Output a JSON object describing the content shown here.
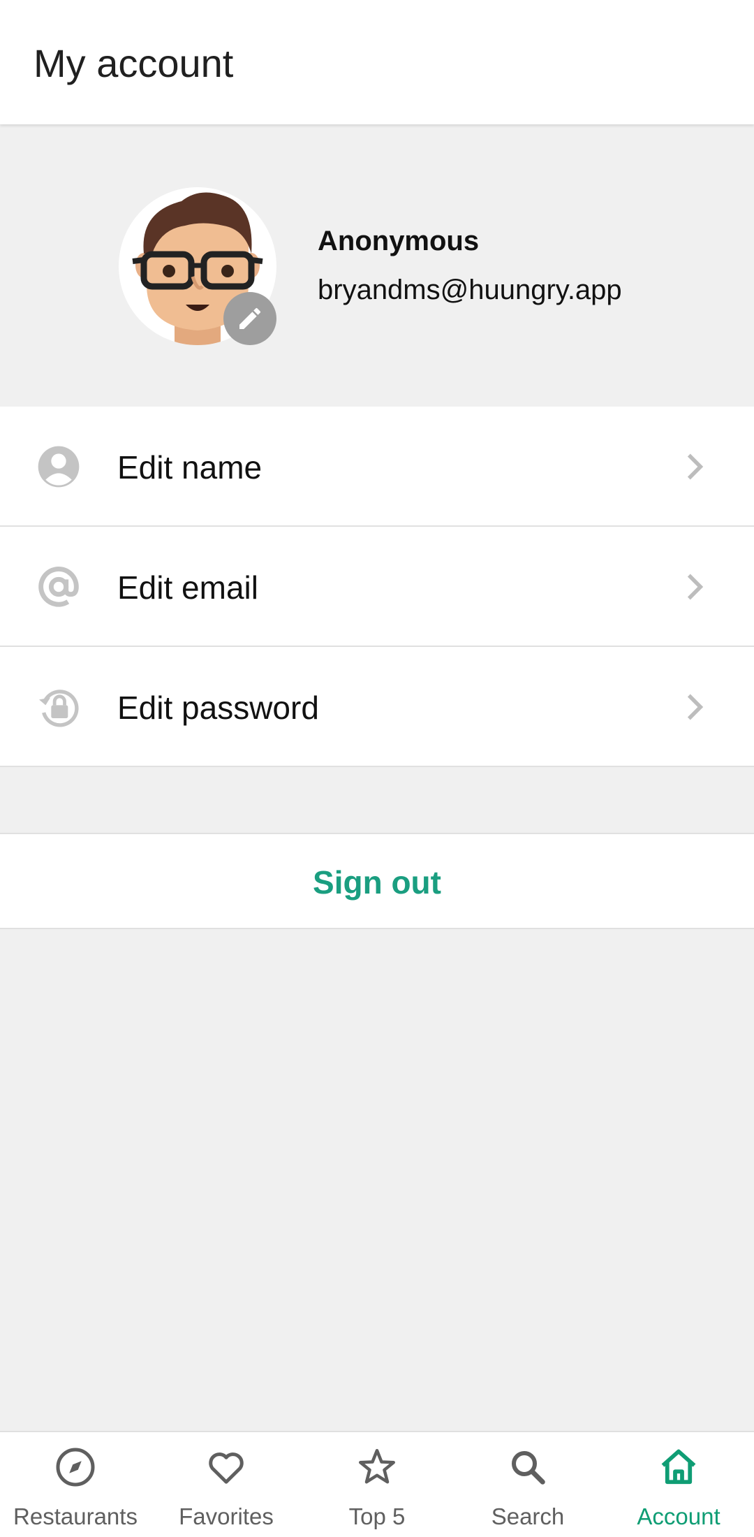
{
  "appbar": {
    "title": "My account"
  },
  "profile": {
    "name": "Anonymous",
    "email": "bryandms@huungry.app",
    "avatar_icon": "avatar-face",
    "edit_icon": "pencil-icon"
  },
  "menu": {
    "items": [
      {
        "label": "Edit name",
        "icon": "person-icon"
      },
      {
        "label": "Edit email",
        "icon": "at-sign-icon"
      },
      {
        "label": "Edit password",
        "icon": "lock-reset-icon"
      }
    ]
  },
  "signout": {
    "label": "Sign out"
  },
  "bottom_nav": {
    "items": [
      {
        "label": "Restaurants",
        "icon": "compass-icon",
        "active": false
      },
      {
        "label": "Favorites",
        "icon": "heart-icon",
        "active": false
      },
      {
        "label": "Top 5",
        "icon": "star-icon",
        "active": false
      },
      {
        "label": "Search",
        "icon": "search-icon",
        "active": false
      },
      {
        "label": "Account",
        "icon": "home-icon",
        "active": true
      }
    ]
  },
  "colors": {
    "accent": "#1a9e80",
    "nav_active": "#0f9d74",
    "icon_gray": "#bdbdbd",
    "background": "#f0f0f0"
  }
}
